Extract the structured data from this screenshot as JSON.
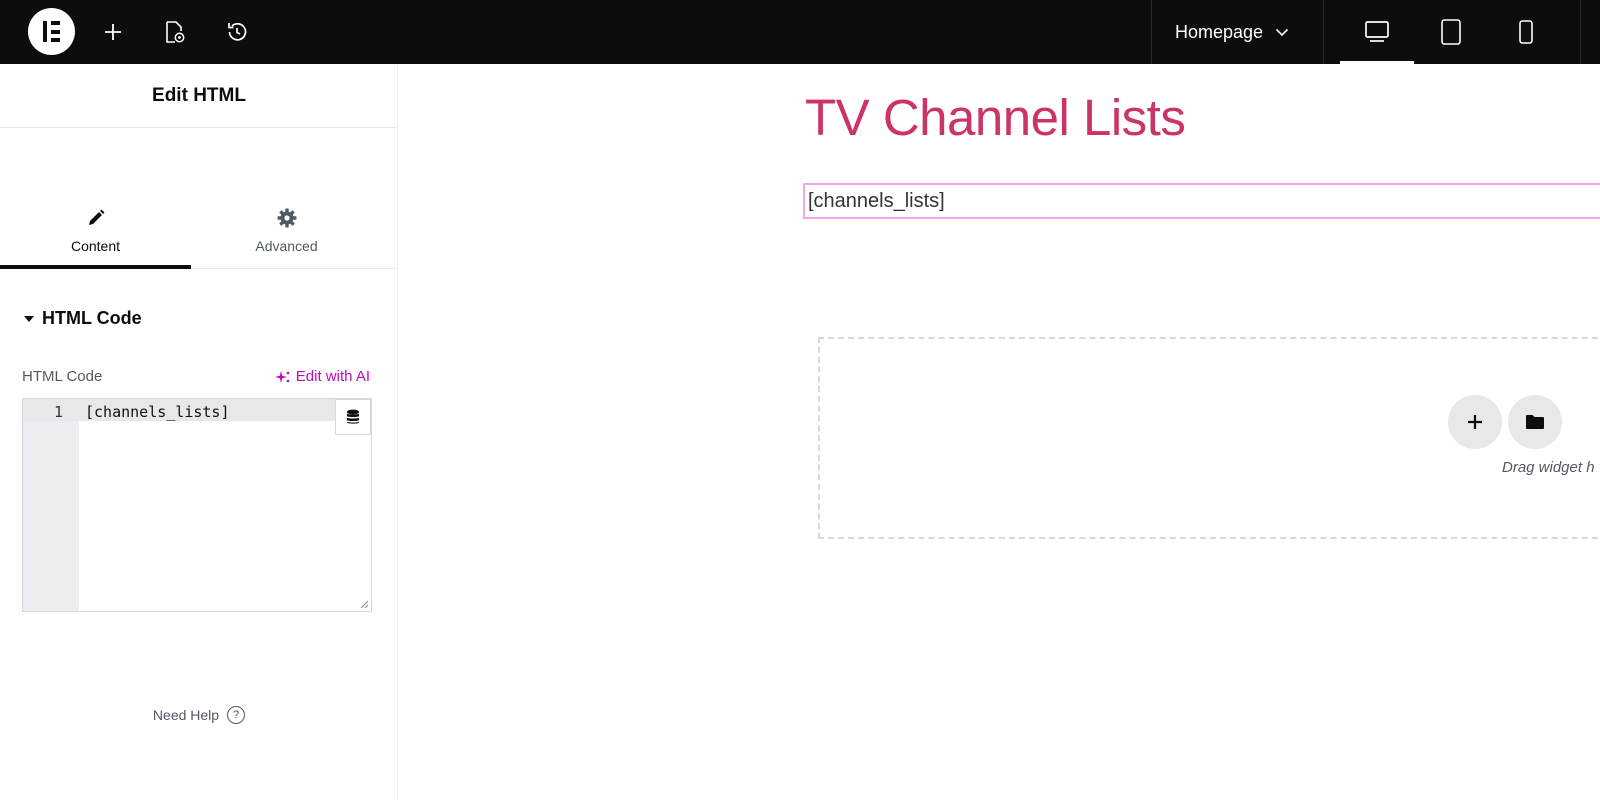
{
  "topbar": {
    "page_name": "Homepage"
  },
  "panel": {
    "title": "Edit HTML",
    "tabs": [
      {
        "label": "Content"
      },
      {
        "label": "Advanced"
      }
    ],
    "section_title": "HTML Code",
    "field_label": "HTML Code",
    "edit_ai_label": "Edit with AI",
    "code": {
      "line_number": "1",
      "text": "[channels_lists]"
    },
    "need_help": "Need Help",
    "help_glyph": "?"
  },
  "canvas": {
    "heading": "TV Channel Lists",
    "html_output": "[channels_lists]",
    "drop_text": "Drag widget h"
  },
  "colors": {
    "topbar_bg": "#0c0d0e",
    "heading": "#cc3366",
    "accent_ai": "#c00bb9",
    "widget_outline": "#f0a7ee"
  }
}
